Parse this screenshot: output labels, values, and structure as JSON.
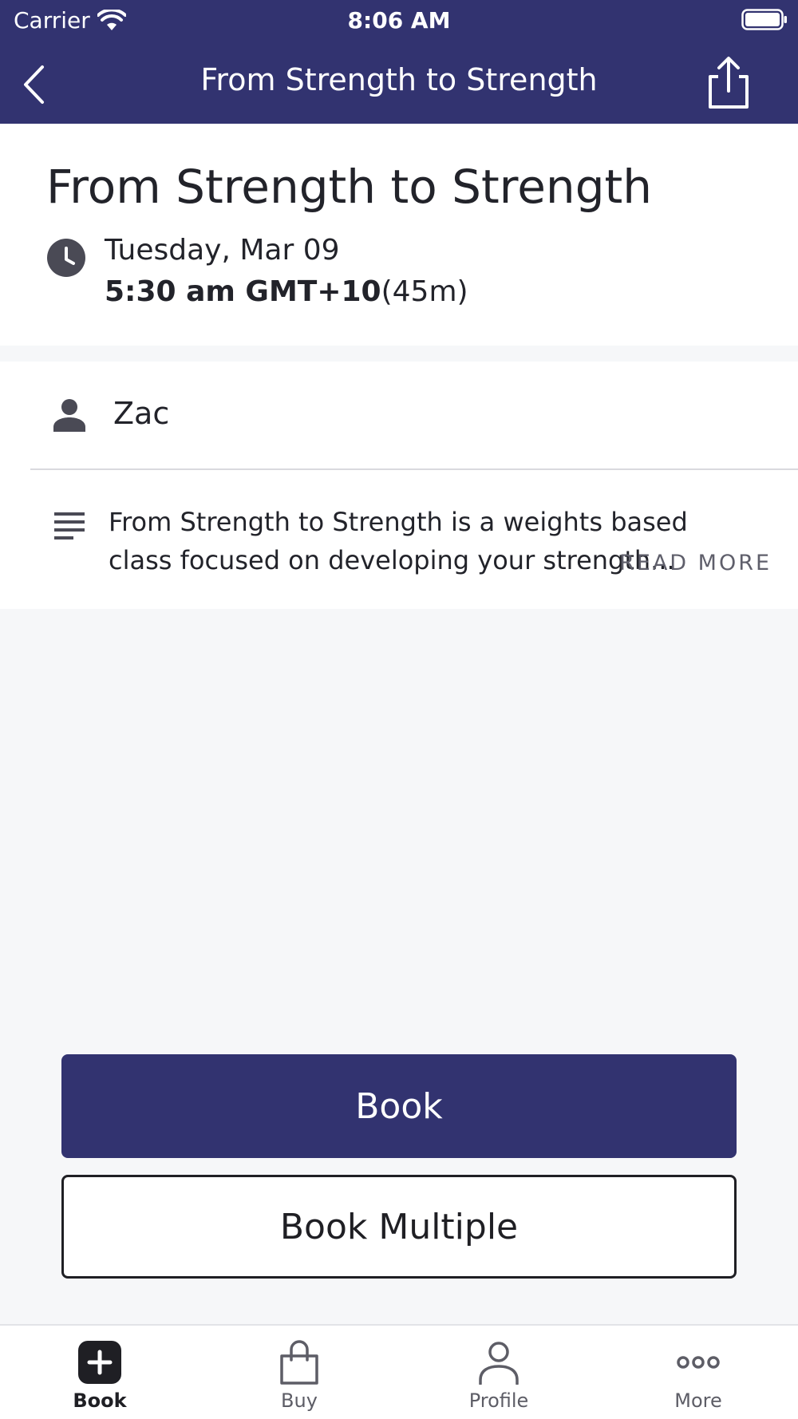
{
  "status_bar": {
    "carrier": "Carrier",
    "time": "8:06 AM"
  },
  "nav": {
    "title": "From Strength to Strength",
    "back_icon": "chevron-left-icon",
    "share_icon": "share-icon"
  },
  "class": {
    "title": "From Strength to Strength",
    "date": "Tuesday, Mar 09",
    "time": "5:30 am GMT+10",
    "duration": "(45m)"
  },
  "details": {
    "instructor": "Zac",
    "description": "From Strength to Strength is a weights based class focused on developing your strength...",
    "read_more": "READ MORE"
  },
  "actions": {
    "book": "Book",
    "book_multiple": "Book Multiple"
  },
  "tabs": [
    {
      "label": "Book",
      "icon": "plus-square-icon",
      "active": true
    },
    {
      "label": "Buy",
      "icon": "shopping-bag-icon",
      "active": false
    },
    {
      "label": "Profile",
      "icon": "person-icon",
      "active": false
    },
    {
      "label": "More",
      "icon": "more-icon",
      "active": false
    }
  ],
  "colors": {
    "primary": "#323370",
    "background": "#f6f7f9",
    "icon": "#4a4a55"
  }
}
